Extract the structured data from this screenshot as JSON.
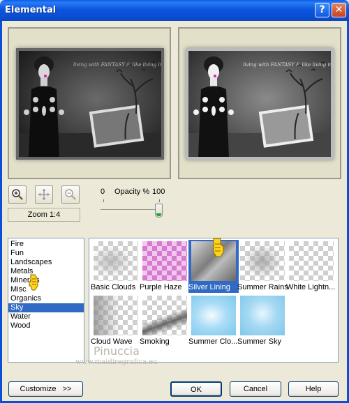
{
  "window": {
    "title": "Elemental",
    "help_label": "?",
    "close_label": "✕"
  },
  "toolbar": {
    "zoom_in_icon": "zoom-in-icon",
    "pan_icon": "pan-icon",
    "zoom_out_icon": "zoom-out-icon",
    "zoom_label": "Zoom 1:4"
  },
  "opacity": {
    "min": "0",
    "label": "Opacity %",
    "max": "100",
    "value": 100
  },
  "preview_text": "living with FANTASY & like living in a DREAM WORLD",
  "categories": {
    "items": [
      "Fire",
      "Fun",
      "Landscapes",
      "Metals",
      "Minerals",
      "Misc",
      "Organics",
      "Sky",
      "Water",
      "Wood"
    ],
    "selected": "Sky"
  },
  "presets": {
    "items": [
      "Basic Clouds",
      "Purple Haze",
      "Silver Lining",
      "Summer Rains",
      "White Lightn...",
      "Cloud Wave",
      "Smoking",
      "Summer Clo...",
      "Summer Sky"
    ],
    "selected": "Silver Lining"
  },
  "watermark": {
    "name": "Pinuccia",
    "url": "www.maidiregrafica.eu"
  },
  "buttons": {
    "customize": "Customize   >>",
    "ok": "OK",
    "cancel": "Cancel",
    "help": "Help"
  },
  "colors": {
    "title_bar": "#0a56df",
    "selection": "#316ac5",
    "dialog_bg": "#ece9d8"
  }
}
